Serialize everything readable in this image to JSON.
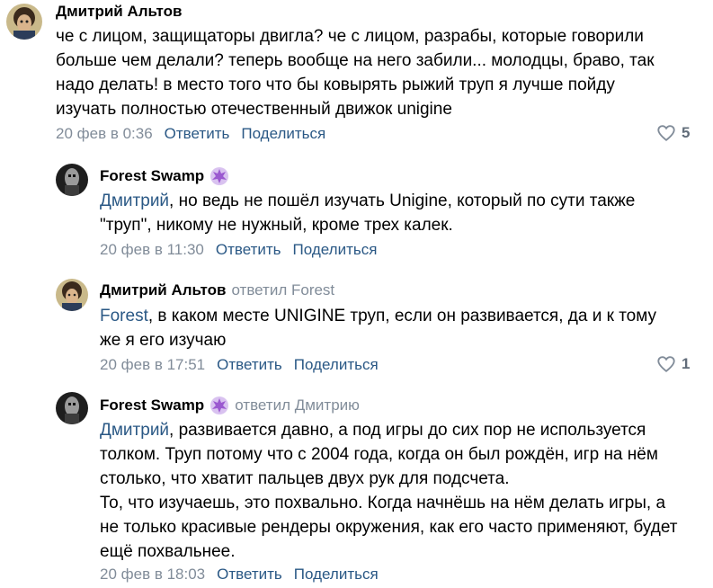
{
  "comments": [
    {
      "author": "Дмитрий Альтов",
      "text": "че с лицом, защищаторы двигла? че с лицом, разрабы, которые говорили больше чем делали? теперь вообще на него забили... молодцы, браво, так надо делать! в место того что бы ковырять рыжий труп я лучше пойду изучать полностью отечественный движок unigine",
      "date": "20 фев в 0:36",
      "reply_label": "Ответить",
      "share_label": "Поделиться",
      "likes": "5"
    },
    {
      "author": "Forest Swamp",
      "mention": "Дмитрий",
      "text": ", но ведь не пошёл изучать Unigine, который по сути также \"труп\", никому не нужный, кроме трех калек.",
      "date": "20 фев в 11:30",
      "reply_label": "Ответить",
      "share_label": "Поделиться"
    },
    {
      "author": "Дмитрий Альтов",
      "replied_to": "ответил Forest",
      "mention": "Forest",
      "text": ", в каком месте UNIGINE труп, если он развивается, да и к тому же я его изучаю",
      "date": "20 фев в 17:51",
      "reply_label": "Ответить",
      "share_label": "Поделиться",
      "likes": "1"
    },
    {
      "author": "Forest Swamp",
      "replied_to": "ответил Дмитрию",
      "mention": "Дмитрий",
      "text": ", развивается давно, а под игры до сих пор не используется толком. Труп потому что с 2004 года, когда он был рождён, игр на нём столько, что хватит пальцев двух рук для подсчета.\nТо, что изучаешь, это похвально. Когда начнёшь на нём делать игры, а не только красивые рендеры окружения, как его часто применяют, будет ещё похвальнее.",
      "date": "20 фев в 18:03",
      "reply_label": "Ответить",
      "share_label": "Поделиться"
    }
  ],
  "icons": {
    "heart": "heart-outline-icon",
    "badge": "prometheus-badge-icon"
  },
  "colors": {
    "link": "#2a5885",
    "secondary": "#818c99",
    "like_count": "#626d7a",
    "badge": "#9b59d0"
  }
}
